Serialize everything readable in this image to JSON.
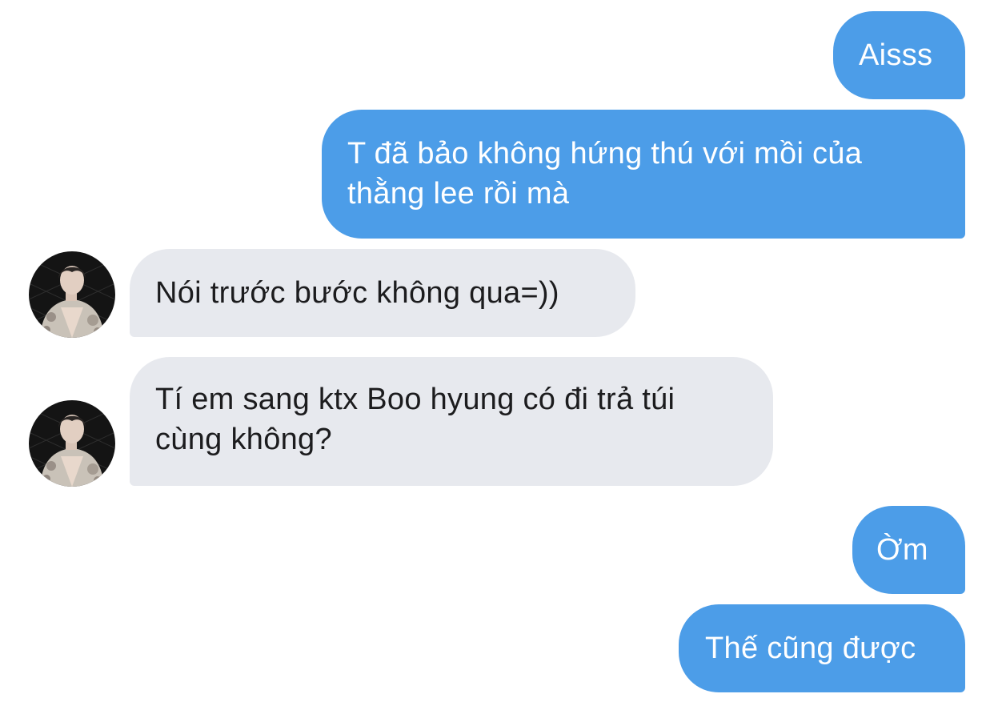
{
  "messages": [
    {
      "id": 1,
      "direction": "sent",
      "text": "Aisss"
    },
    {
      "id": 2,
      "direction": "sent",
      "text": "T đã bảo không hứng thú với mồi của thằng lee rồi mà"
    },
    {
      "id": 3,
      "direction": "received",
      "text": "Nói trước bước không qua=))"
    },
    {
      "id": 4,
      "direction": "received",
      "text": "Tí em sang ktx Boo hyung có đi trả túi cùng không?"
    },
    {
      "id": 5,
      "direction": "sent",
      "text": "Ờm"
    },
    {
      "id": 6,
      "direction": "sent",
      "text": "Thế cũng được"
    }
  ],
  "colors": {
    "sent_bubble": "#4c9de8",
    "received_bubble": "#e7e9ee",
    "background": "#ffffff"
  }
}
